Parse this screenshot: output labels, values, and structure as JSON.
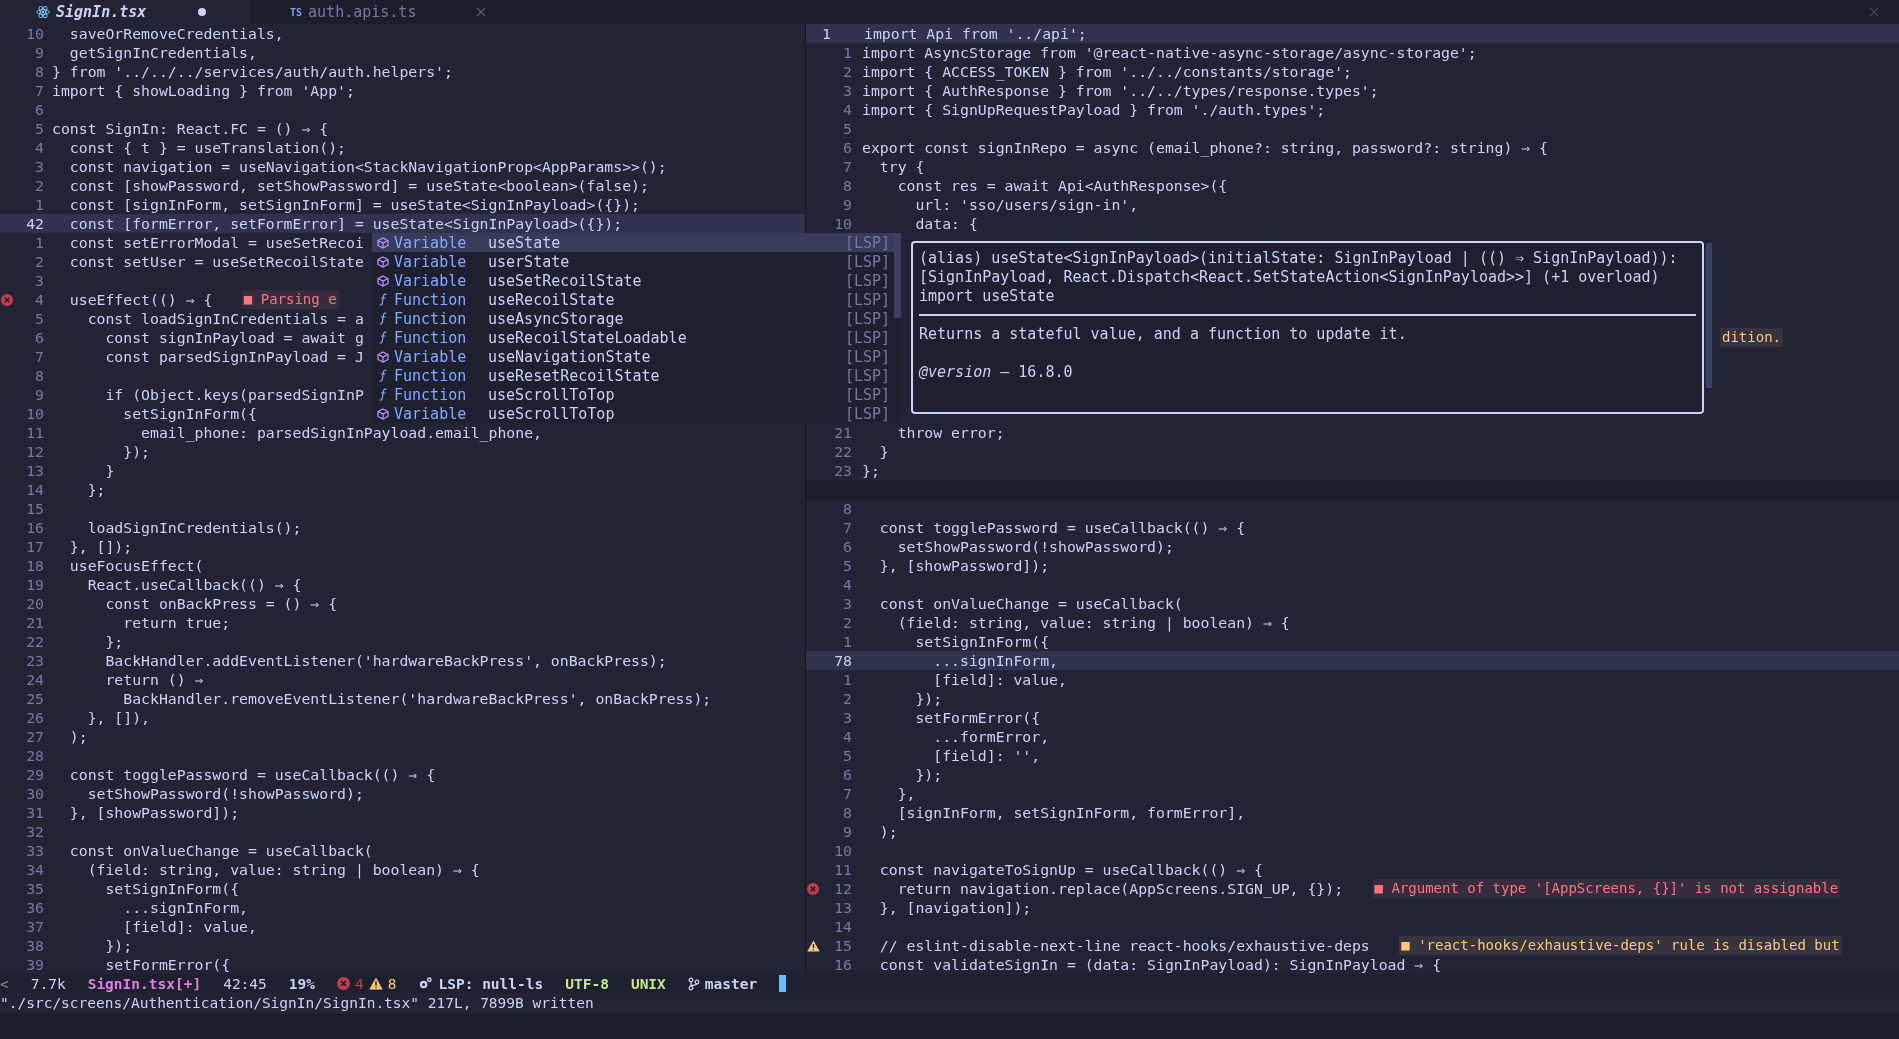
{
  "tabs": [
    {
      "kind": "react",
      "label": "SignIn.tsx",
      "modified": true,
      "selected": true
    },
    {
      "kind": "typescript",
      "badge": "TS",
      "label": "auth.apis.ts",
      "modified": false,
      "selected": false
    }
  ],
  "left_pane": {
    "lines": [
      {
        "n": "10",
        "text": "  saveOrRemoveCredentials,",
        "current": false
      },
      {
        "n": "9",
        "text": "  getSignInCredentials,",
        "current": false
      },
      {
        "n": "8",
        "text": "} from '../../../services/auth/auth.helpers';",
        "current": false
      },
      {
        "n": "7",
        "text": "import { showLoading } from 'App';",
        "current": false
      },
      {
        "n": "6",
        "current": false
      },
      {
        "n": "5",
        "text": "const SignIn: React.FC = () ⇒ {",
        "current": false
      },
      {
        "n": "4",
        "text": "  const { t } = useTranslation();",
        "current": false
      },
      {
        "n": "3",
        "text": "  const navigation = useNavigation<StackNavigationProp<AppParams>>();",
        "current": false
      },
      {
        "n": "2",
        "text": "  const [showPassword, setShowPassword] = useState<boolean>(false);",
        "current": false
      },
      {
        "n": "1",
        "text": "  const [signInForm, setSignInForm] = useState<SignInPayload>({});",
        "current": false
      },
      {
        "n": "42",
        "text": "  const [formError, setFormError] = useState<SignInPayload>({});",
        "current": true
      },
      {
        "n": "1",
        "text": "  const setErrorModal = useSetRecoi",
        "current": false
      },
      {
        "n": "2",
        "text": "  const setUser = useSetRecoilState",
        "current": false
      },
      {
        "n": "3",
        "current": false
      },
      {
        "n": "4",
        "text": "  useEffect(() ⇒ {",
        "current": false,
        "diagnostic": {
          "kind": "error",
          "message": "■ Parsing e"
        }
      },
      {
        "n": "5",
        "text": "    const loadSignInCredentials = a",
        "current": false
      },
      {
        "n": "6",
        "text": "      const signInPayload = await g",
        "current": false
      },
      {
        "n": "7",
        "text": "      const parsedSignInPayload = J",
        "current": false
      },
      {
        "n": "8",
        "current": false
      },
      {
        "n": "9",
        "text": "      if (Object.keys(parsedSignInP",
        "current": false
      },
      {
        "n": "10",
        "text": "        setSignInForm({",
        "current": false
      },
      {
        "n": "11",
        "text": "          email_phone: parsedSignInPayload.email_phone,",
        "current": false
      },
      {
        "n": "12",
        "text": "        });",
        "current": false
      },
      {
        "n": "13",
        "text": "      }",
        "current": false
      },
      {
        "n": "14",
        "text": "    };",
        "current": false
      },
      {
        "n": "15",
        "current": false
      },
      {
        "n": "16",
        "text": "    loadSignInCredentials();",
        "current": false
      },
      {
        "n": "17",
        "text": "  }, []);",
        "current": false
      },
      {
        "n": "18",
        "text": "  useFocusEffect(",
        "current": false
      },
      {
        "n": "19",
        "text": "    React.useCallback(() ⇒ {",
        "current": false
      },
      {
        "n": "20",
        "text": "      const onBackPress = () ⇒ {",
        "current": false
      },
      {
        "n": "21",
        "text": "        return true;",
        "current": false
      },
      {
        "n": "22",
        "text": "      };",
        "current": false
      },
      {
        "n": "23",
        "text": "      BackHandler.addEventListener('hardwareBackPress', onBackPress);",
        "current": false
      },
      {
        "n": "24",
        "text": "      return () ⇒",
        "current": false
      },
      {
        "n": "25",
        "text": "        BackHandler.removeEventListener('hardwareBackPress', onBackPress);",
        "current": false
      },
      {
        "n": "26",
        "text": "    }, []),",
        "current": false
      },
      {
        "n": "27",
        "text": "  );",
        "current": false
      },
      {
        "n": "28",
        "current": false
      },
      {
        "n": "29",
        "text": "  const togglePassword = useCallback(() ⇒ {",
        "current": false
      },
      {
        "n": "30",
        "text": "    setShowPassword(!showPassword);",
        "current": false
      },
      {
        "n": "31",
        "text": "  }, [showPassword]);",
        "current": false
      },
      {
        "n": "32",
        "current": false
      },
      {
        "n": "33",
        "text": "  const onValueChange = useCallback(",
        "current": false
      },
      {
        "n": "34",
        "text": "    (field: string, value: string | boolean) ⇒ {",
        "current": false
      },
      {
        "n": "35",
        "text": "      setSignInForm({",
        "current": false
      },
      {
        "n": "36",
        "text": "        ...signInForm,",
        "current": false
      },
      {
        "n": "37",
        "text": "        [field]: value,",
        "current": false
      },
      {
        "n": "38",
        "text": "      });",
        "current": false
      },
      {
        "n": "39",
        "text": "      setFormError({",
        "current": false
      }
    ]
  },
  "right_top_pane": {
    "lines": [
      {
        "n": "1",
        "text": "import Api from '../api';",
        "current": true
      },
      {
        "n": "1",
        "text": "import AsyncStorage from '@react-native-async-storage/async-storage';",
        "current": false
      },
      {
        "n": "2",
        "text": "import { ACCESS_TOKEN } from '../../constants/storage';",
        "current": false
      },
      {
        "n": "3",
        "text": "import { AuthResponse } from '../../types/response.types';",
        "current": false
      },
      {
        "n": "4",
        "text": "import { SignUpRequestPayload } from './auth.types';",
        "current": false
      },
      {
        "n": "5",
        "current": false
      },
      {
        "n": "6",
        "text": "export const signInRepo = async (email_phone?: string, password?: string) ⇒ {",
        "current": false
      },
      {
        "n": "7",
        "text": "  try {",
        "current": false
      },
      {
        "n": "8",
        "text": "    const res = await Api<AuthResponse>({",
        "current": false
      },
      {
        "n": "9",
        "text": "      url: 'sso/users/sign-in',",
        "current": false
      },
      {
        "n": "10",
        "text": "      data: {",
        "current": false
      },
      {
        "current": false
      },
      {
        "current": false
      },
      {
        "current": false
      },
      {
        "current": false
      },
      {
        "current": false
      },
      {
        "current": false,
        "diagnostic": {
          "kind": "warning",
          "message": "dition."
        }
      },
      {
        "current": false
      },
      {
        "current": false
      },
      {
        "current": false
      },
      {
        "current": false
      },
      {
        "n": "21",
        "text": "    throw error;",
        "current": false
      },
      {
        "n": "22",
        "text": "  }",
        "current": false
      },
      {
        "n": "23",
        "text": "};",
        "current": false
      }
    ]
  },
  "right_bottom_pane": {
    "lines": [
      {
        "n": "8",
        "current": false
      },
      {
        "n": "7",
        "text": "  const togglePassword = useCallback(() ⇒ {",
        "current": false
      },
      {
        "n": "6",
        "text": "    setShowPassword(!showPassword);",
        "current": false
      },
      {
        "n": "5",
        "text": "  }, [showPassword]);",
        "current": false
      },
      {
        "n": "4",
        "current": false
      },
      {
        "n": "3",
        "text": "  const onValueChange = useCallback(",
        "current": false
      },
      {
        "n": "2",
        "text": "    (field: string, value: string | boolean) ⇒ {",
        "current": false
      },
      {
        "n": "1",
        "text": "      setSignInForm({",
        "current": false
      },
      {
        "n": "78",
        "text": "        ...signInForm,",
        "current": true
      },
      {
        "n": "1",
        "text": "        [field]: value,",
        "current": false
      },
      {
        "n": "2",
        "text": "      });",
        "current": false
      },
      {
        "n": "3",
        "text": "      setFormError({",
        "current": false
      },
      {
        "n": "4",
        "text": "        ...formError,",
        "current": false
      },
      {
        "n": "5",
        "text": "        [field]: '',",
        "current": false
      },
      {
        "n": "6",
        "text": "      });",
        "current": false
      },
      {
        "n": "7",
        "text": "    },",
        "current": false
      },
      {
        "n": "8",
        "text": "    [signInForm, setSignInForm, formError],",
        "current": false
      },
      {
        "n": "9",
        "text": "  );",
        "current": false
      },
      {
        "n": "10",
        "current": false
      },
      {
        "n": "11",
        "text": "  const navigateToSignUp = useCallback(() ⇒ {",
        "current": false
      },
      {
        "n": "12",
        "text": "    return navigation.replace(AppScreens.SIGN_UP, {});",
        "current": false,
        "diagnostic": {
          "kind": "error",
          "message": "■ Argument of type '[AppScreens, {}]' is not assignable"
        }
      },
      {
        "n": "13",
        "text": "  }, [navigation]);",
        "current": false
      },
      {
        "n": "14",
        "current": false
      },
      {
        "n": "15",
        "text": "  // eslint-disable-next-line react-hooks/exhaustive-deps",
        "current": false,
        "diagnostic": {
          "kind": "warning",
          "message": "■ 'react-hooks/exhaustive-deps' rule is disabled but"
        }
      },
      {
        "n": "16",
        "text": "  const validateSignIn = (data: SignInPayload): SignInPayload ⇒ {",
        "current": false
      }
    ]
  },
  "completion_menu": {
    "items": [
      {
        "kind": "variable",
        "kind_label": "Variable",
        "label": "useState",
        "source": "[LSP]",
        "selected": true
      },
      {
        "kind": "variable",
        "kind_label": "Variable",
        "label": "userState",
        "source": "[LSP]",
        "selected": false
      },
      {
        "kind": "variable",
        "kind_label": "Variable",
        "label": "useSetRecoilState",
        "source": "[LSP]",
        "selected": false
      },
      {
        "kind": "function",
        "kind_label": "Function",
        "label": "useRecoilState",
        "source": "[LSP]",
        "selected": false
      },
      {
        "kind": "function",
        "kind_label": "Function",
        "label": "useAsyncStorage",
        "source": "[LSP]",
        "selected": false
      },
      {
        "kind": "function",
        "kind_label": "Function",
        "label": "useRecoilStateLoadable",
        "source": "[LSP]",
        "selected": false
      },
      {
        "kind": "variable",
        "kind_label": "Variable",
        "label": "useNavigationState",
        "source": "[LSP]",
        "selected": false
      },
      {
        "kind": "function",
        "kind_label": "Function",
        "label": "useResetRecoilState",
        "source": "[LSP]",
        "selected": false
      },
      {
        "kind": "function",
        "kind_label": "Function",
        "label": "useScrollToTop",
        "source": "[LSP]",
        "selected": false
      },
      {
        "kind": "variable",
        "kind_label": "Variable",
        "label": "useScrollToTop",
        "source": "[LSP]",
        "selected": false
      }
    ]
  },
  "hover_doc": {
    "signature": [
      "(alias) useState<SignInPayload>(initialState: SignInPayload | (() ⇒ SignInPayload)):",
      "[SignInPayload, React.Dispatch<React.SetStateAction<SignInPayload>>] (+1 overload)",
      "import useState"
    ],
    "description": "Returns a stateful value, and a function to update it.",
    "version": "*@version* — 16.8.0"
  },
  "status_bar": {
    "left_marker": "<",
    "size": "7.7k",
    "file": "SignIn.tsx[+]",
    "position": "42:45",
    "percent": "19%",
    "errors": "4",
    "warnings": "8",
    "lsp": "LSP: null-ls",
    "encoding": "UTF-8",
    "format": "UNIX",
    "branch": "master"
  },
  "command_line": "\"./src/screens/Authentication/SignIn/SignIn.tsx\" 217L, 7899B written"
}
